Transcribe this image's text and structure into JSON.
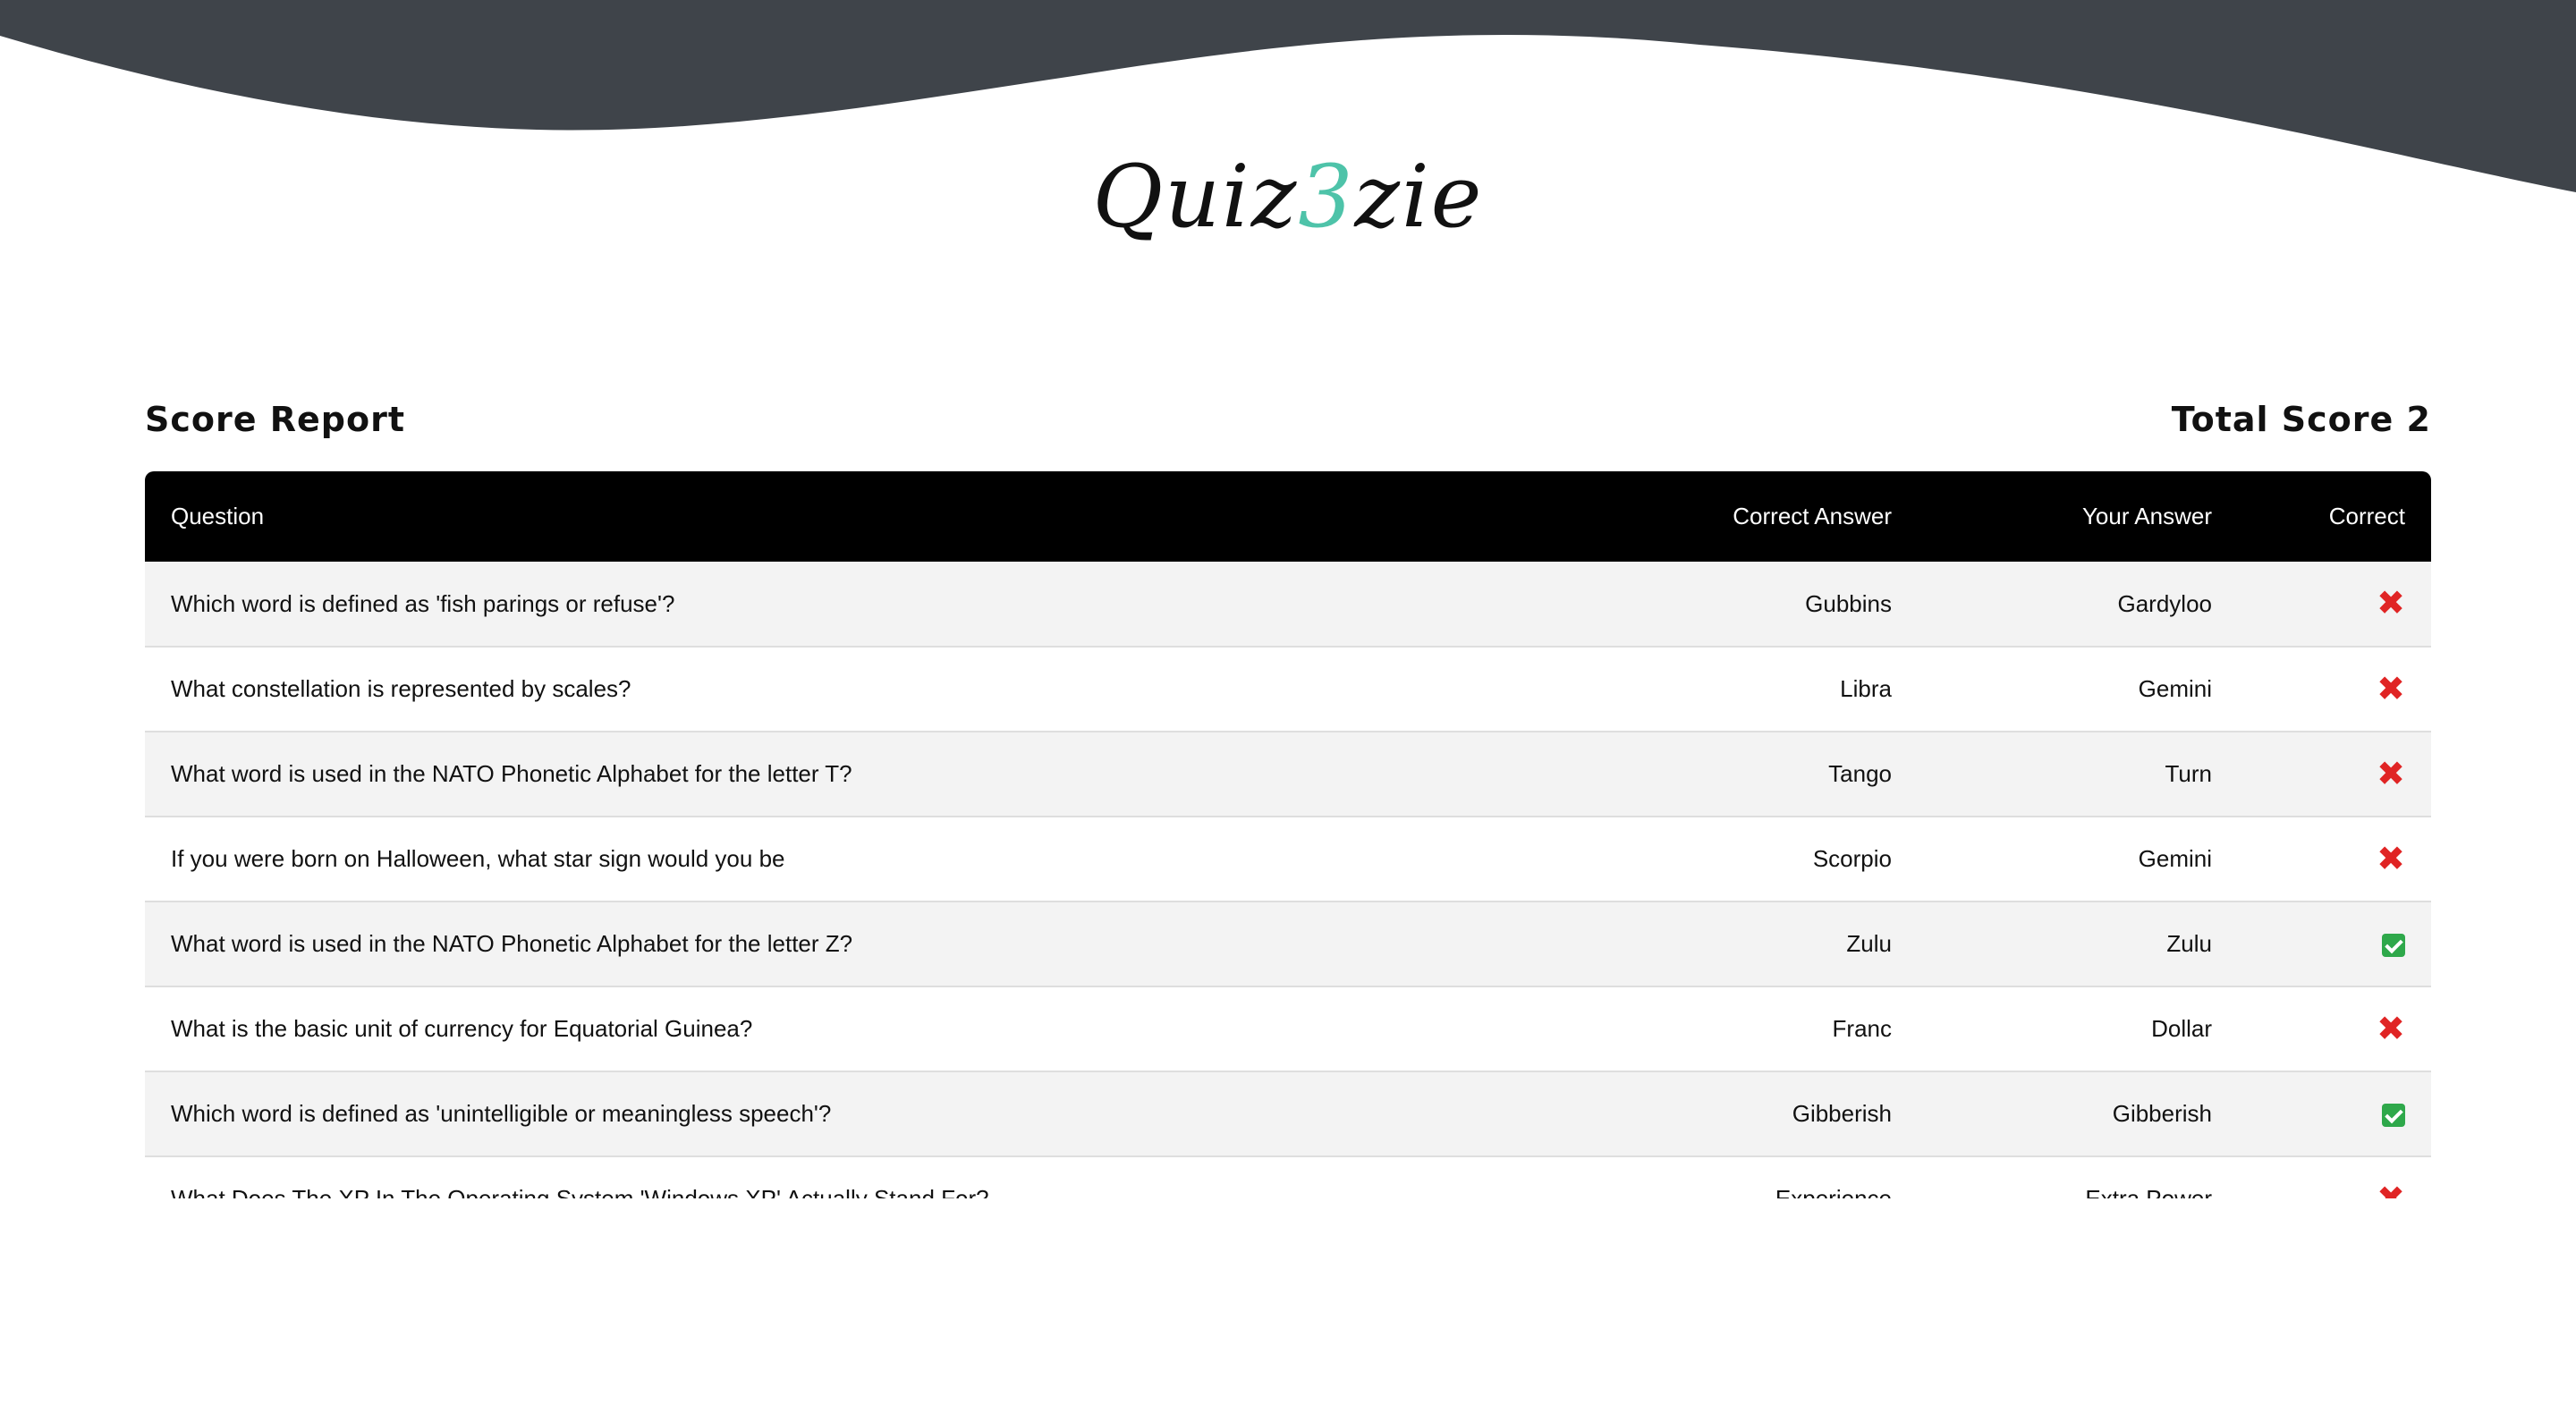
{
  "logo": {
    "before": "Quiz",
    "accent": "3",
    "after": "zie",
    "accent_color": "#4ec3a9"
  },
  "report": {
    "title": "Score Report",
    "total_label": "Total Score",
    "total_value": "2"
  },
  "table": {
    "headers": {
      "question": "Question",
      "correct_answer": "Correct Answer",
      "your_answer": "Your Answer",
      "correct": "Correct"
    },
    "rows": [
      {
        "question": "Which word is defined as 'fish parings or refuse'?",
        "correct_answer": "Gubbins",
        "your_answer": "Gardyloo",
        "is_correct": false
      },
      {
        "question": "What constellation is represented by scales?",
        "correct_answer": "Libra",
        "your_answer": "Gemini",
        "is_correct": false
      },
      {
        "question": "What word is used in the NATO Phonetic Alphabet for the letter T?",
        "correct_answer": "Tango",
        "your_answer": "Turn",
        "is_correct": false
      },
      {
        "question": "If you were born on Halloween, what star sign would you be",
        "correct_answer": "Scorpio",
        "your_answer": "Gemini",
        "is_correct": false
      },
      {
        "question": "What word is used in the NATO Phonetic Alphabet for the letter Z?",
        "correct_answer": "Zulu",
        "your_answer": "Zulu",
        "is_correct": true
      },
      {
        "question": "What is the basic unit of currency for Equatorial Guinea?",
        "correct_answer": "Franc",
        "your_answer": "Dollar",
        "is_correct": false
      },
      {
        "question": "Which word is defined as 'unintelligible or meaningless speech'?",
        "correct_answer": "Gibberish",
        "your_answer": "Gibberish",
        "is_correct": true
      },
      {
        "question": "What Does The XP In The Operating System 'Windows XP' Actually Stand For?",
        "correct_answer": "Experience",
        "your_answer": "Extra Power",
        "is_correct": false
      }
    ]
  },
  "colors": {
    "wave": "#3f444a",
    "header_bg": "#000000",
    "wrong": "#e02424",
    "right": "#2ea84a"
  }
}
